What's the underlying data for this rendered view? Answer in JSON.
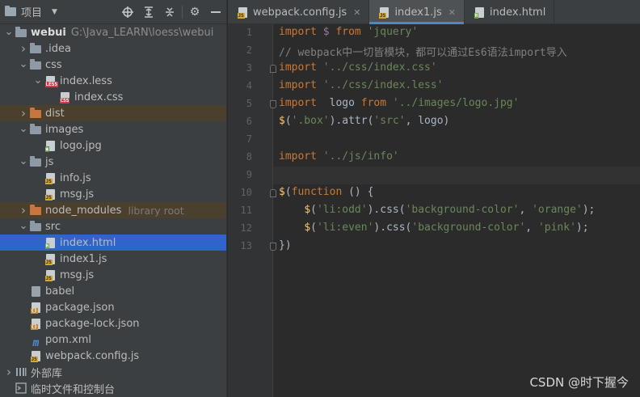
{
  "project_panel": {
    "title": "项目",
    "tools": [
      "crosshair-icon",
      "expand-all-icon",
      "collapse-all-icon",
      "gear-icon",
      "minimize-icon"
    ]
  },
  "tree": [
    {
      "label": "webui",
      "path": "G:\\Java_LEARN\\loess\\webui",
      "indent": 0,
      "arrow": "down",
      "icon": "folder",
      "bold": true
    },
    {
      "label": ".idea",
      "indent": 1,
      "arrow": "right",
      "icon": "folder"
    },
    {
      "label": "css",
      "indent": 1,
      "arrow": "down",
      "icon": "folder"
    },
    {
      "label": "index.less",
      "indent": 2,
      "arrow": "down",
      "icon": "less"
    },
    {
      "label": "index.css",
      "indent": 3,
      "arrow": "",
      "icon": "css"
    },
    {
      "label": "dist",
      "indent": 1,
      "arrow": "right",
      "icon": "folder-orange",
      "highlight": true
    },
    {
      "label": "images",
      "indent": 1,
      "arrow": "down",
      "icon": "folder"
    },
    {
      "label": "logo.jpg",
      "indent": 2,
      "arrow": "",
      "icon": "img"
    },
    {
      "label": "js",
      "indent": 1,
      "arrow": "down",
      "icon": "folder"
    },
    {
      "label": "info.js",
      "indent": 2,
      "arrow": "",
      "icon": "js"
    },
    {
      "label": "msg.js",
      "indent": 2,
      "arrow": "",
      "icon": "js"
    },
    {
      "label": "node_modules",
      "hint": "library root",
      "indent": 1,
      "arrow": "right",
      "icon": "folder-orange",
      "highlight": true
    },
    {
      "label": "src",
      "indent": 1,
      "arrow": "down",
      "icon": "folder"
    },
    {
      "label": "index.html",
      "indent": 2,
      "arrow": "",
      "icon": "html",
      "selected": true
    },
    {
      "label": "index1.js",
      "indent": 2,
      "arrow": "",
      "icon": "js"
    },
    {
      "label": "msg.js",
      "indent": 2,
      "arrow": "",
      "icon": "js"
    },
    {
      "label": "babel",
      "indent": 1,
      "arrow": "",
      "icon": "file"
    },
    {
      "label": "package.json",
      "indent": 1,
      "arrow": "",
      "icon": "json"
    },
    {
      "label": "package-lock.json",
      "indent": 1,
      "arrow": "",
      "icon": "json"
    },
    {
      "label": "pom.xml",
      "indent": 1,
      "arrow": "",
      "icon": "maven"
    },
    {
      "label": "webpack.config.js",
      "indent": 1,
      "arrow": "",
      "icon": "js"
    },
    {
      "label": "外部库",
      "indent": 0,
      "arrow": "right",
      "icon": "lib"
    },
    {
      "label": "临时文件和控制台",
      "indent": 0,
      "arrow": "",
      "icon": "scratch"
    }
  ],
  "tabs": [
    {
      "label": "webpack.config.js",
      "icon": "js",
      "active": false
    },
    {
      "label": "index1.js",
      "icon": "js",
      "active": true
    },
    {
      "label": "index.html",
      "icon": "html",
      "active": false
    }
  ],
  "code_lines": [
    {
      "n": "1",
      "parts": [
        [
          "kw",
          "import "
        ],
        [
          "pur",
          "$ "
        ],
        [
          "kw",
          "from "
        ],
        [
          "str",
          "'jquery'"
        ]
      ]
    },
    {
      "n": "2",
      "parts": [
        [
          "cmt",
          "// webpack中一切皆模块，都可以通过Es6语法import导入"
        ]
      ]
    },
    {
      "n": "3",
      "parts": [
        [
          "kw",
          "import "
        ],
        [
          "str",
          "'../css/index.css'"
        ]
      ]
    },
    {
      "n": "4",
      "parts": [
        [
          "kw",
          "import "
        ],
        [
          "str",
          "'../css/index.less'"
        ]
      ]
    },
    {
      "n": "5",
      "parts": [
        [
          "kw",
          "import  "
        ],
        [
          "plain",
          "logo "
        ],
        [
          "kw",
          "from "
        ],
        [
          "str",
          "'../images/logo.jpg'"
        ]
      ]
    },
    {
      "n": "6",
      "parts": [
        [
          "fn",
          "$"
        ],
        [
          "plain",
          "("
        ],
        [
          "str",
          "'.box'"
        ],
        [
          "plain",
          ")."
        ],
        [
          "plain",
          "attr("
        ],
        [
          "str",
          "'src'"
        ],
        [
          "plain",
          ", logo)"
        ]
      ]
    },
    {
      "n": "7",
      "parts": []
    },
    {
      "n": "8",
      "parts": [
        [
          "kw",
          "import "
        ],
        [
          "str",
          "'../js/info'"
        ]
      ]
    },
    {
      "n": "9",
      "parts": []
    },
    {
      "n": "10",
      "parts": [
        [
          "fn",
          "$"
        ],
        [
          "plain",
          "("
        ],
        [
          "kw",
          "function "
        ],
        [
          "plain",
          "() {"
        ]
      ]
    },
    {
      "n": "11",
      "parts": [
        [
          "plain",
          "    "
        ],
        [
          "fn",
          "$"
        ],
        [
          "plain",
          "("
        ],
        [
          "str",
          "'li:odd'"
        ],
        [
          "plain",
          ").css("
        ],
        [
          "str",
          "'background-color'"
        ],
        [
          "plain",
          ", "
        ],
        [
          "str",
          "'orange'"
        ],
        [
          "plain",
          ");"
        ]
      ]
    },
    {
      "n": "12",
      "parts": [
        [
          "plain",
          "    "
        ],
        [
          "fn",
          "$"
        ],
        [
          "plain",
          "("
        ],
        [
          "str",
          "'li:even'"
        ],
        [
          "plain",
          ").css("
        ],
        [
          "str",
          "'background-color'"
        ],
        [
          "plain",
          ", "
        ],
        [
          "str",
          "'pink'"
        ],
        [
          "plain",
          ");"
        ]
      ]
    },
    {
      "n": "13",
      "parts": [
        [
          "plain",
          "})"
        ]
      ]
    }
  ],
  "watermark": "CSDN @时下握今",
  "colors": {
    "selection": "#2f65ca",
    "panel": "#3c3f41",
    "editor": "#2b2b2b",
    "keyword": "#cc7832",
    "string": "#6a8759"
  }
}
